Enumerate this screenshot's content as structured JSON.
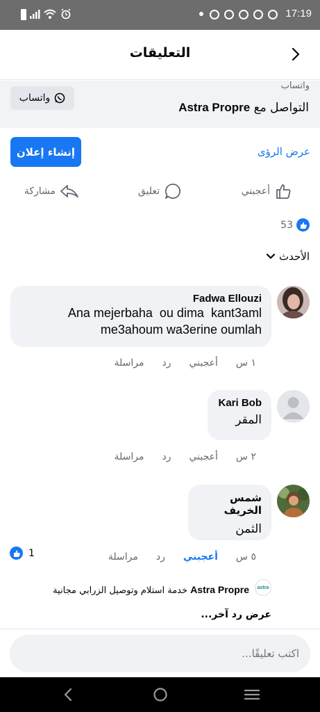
{
  "status": {
    "time": "17:19"
  },
  "header": {
    "title": "التعليقات"
  },
  "sponsor": {
    "small_label": "واتساب",
    "line_prefix": "التواصل مع",
    "page_name": "Astra Propre",
    "button_label": "واتساب"
  },
  "cta": {
    "create_ad": "إنشاء إعلان",
    "insights": "عرض الرؤى"
  },
  "actions": {
    "like": "أعجبني",
    "comment": "تعليق",
    "share": "مشاركة"
  },
  "reactions": {
    "count": "53"
  },
  "sort": {
    "label": "الأحدث"
  },
  "comments": [
    {
      "name": "Fadwa Ellouzi",
      "text_line1": "Ana mejerbaha  ou dima  kant3aml",
      "text_line2": "me3ahoum wa3erine oumlah",
      "time": "١ س",
      "like": "أعجبني",
      "reply": "رد",
      "message": "مراسلة"
    },
    {
      "name": "Kari Bob",
      "text": "المقر",
      "time": "٢ س",
      "like": "أعجبني",
      "reply": "رد",
      "message": "مراسلة"
    },
    {
      "name": "شمس الخريف",
      "text": "الثمن",
      "time": "٥ س",
      "like": "أعجبني",
      "reply": "رد",
      "message": "مراسلة",
      "reaction_count": "1"
    }
  ],
  "reply_preview": {
    "name": "Astra Propre",
    "text": "خدمة استلام وتوصيل الزرابي مجانية",
    "logo_text": "astra"
  },
  "more_replies": "عرض رد آخر...",
  "composer": {
    "placeholder": "اكتب تعليقًا..."
  },
  "colors": {
    "accent": "#1877f2",
    "bubble": "#f0f2f5",
    "statusbar": "#6d6d6d"
  },
  "icons": [
    "whatsapp-icon",
    "thumb-up-icon",
    "comment-icon",
    "share-icon",
    "chevron-down-icon",
    "back-arrow-icon"
  ]
}
